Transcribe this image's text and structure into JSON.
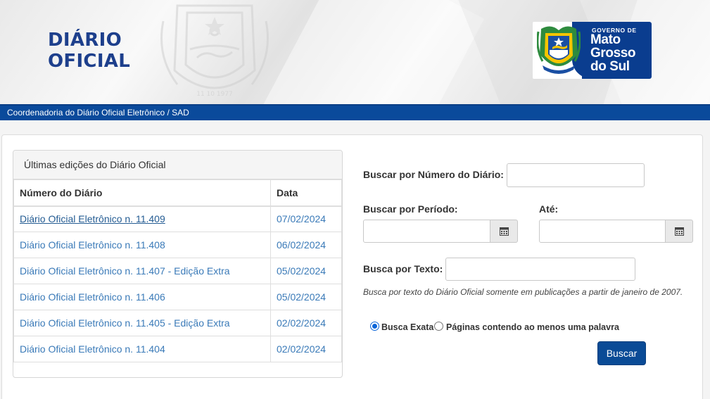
{
  "header": {
    "title_line1": "DIÁRIO",
    "title_line2": "OFICIAL",
    "gov_logo_line1": "GOVERNO DE",
    "gov_logo_line2": "Mato Grosso do Sul",
    "watermark_text": "11 10 1977",
    "subtitle": "Coordenadoria do Diário Oficial Eletrônico / SAD"
  },
  "editions": {
    "heading": "Últimas edições do Diário Oficial",
    "columns": [
      "Número do Diário",
      "Data"
    ],
    "rows": [
      {
        "name": "Diário Oficial Eletrônico n. 11.409",
        "date": "07/02/2024"
      },
      {
        "name": "Diário Oficial Eletrônico n. 11.408",
        "date": "06/02/2024"
      },
      {
        "name": "Diário Oficial Eletrônico n. 11.407 - Edição Extra",
        "date": "05/02/2024"
      },
      {
        "name": "Diário Oficial Eletrônico n. 11.406",
        "date": "05/02/2024"
      },
      {
        "name": "Diário Oficial Eletrônico n. 11.405 - Edição Extra",
        "date": "02/02/2024"
      },
      {
        "name": "Diário Oficial Eletrônico n. 11.404",
        "date": "02/02/2024"
      }
    ]
  },
  "search": {
    "number_label": "Buscar por Número do Diário:",
    "number_value": "",
    "period_label": "Buscar por Período:",
    "period_from_value": "",
    "until_label": "Até:",
    "period_to_value": "",
    "text_label": "Busca por Texto:",
    "text_value": "",
    "help_text": "Busca por texto do Diário Oficial somente em publicações a partir de janeiro de 2007.",
    "option_exact": "Busca Exata",
    "option_any": "Páginas contendo ao menos uma palavra",
    "selected_option": "exact",
    "button_label": "Buscar"
  },
  "icons": [
    "calendar-icon",
    "state-coat-of-arms-icon"
  ],
  "colors": {
    "brand_blue": "#0a4a9b",
    "title_blue": "#1d3f8c",
    "link_blue": "#3a7ab8"
  }
}
